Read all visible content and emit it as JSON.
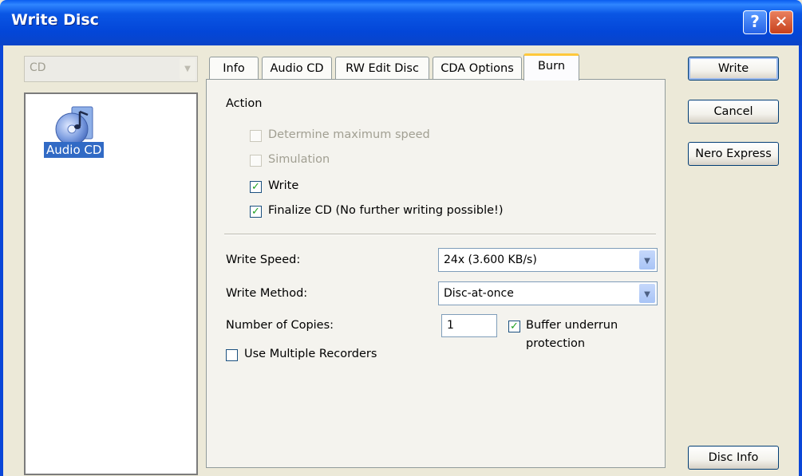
{
  "window": {
    "title": "Write Disc"
  },
  "title_buttons": {
    "help": "?",
    "close": "✕"
  },
  "disc_type": {
    "value": "CD"
  },
  "compilation_list": {
    "items": [
      {
        "label": "Audio CD",
        "icon": "audio-cd-icon"
      }
    ]
  },
  "tabs": [
    {
      "label": "Info"
    },
    {
      "label": "Audio CD"
    },
    {
      "label": "RW Edit Disc"
    },
    {
      "label": "CDA Options"
    },
    {
      "label": "Burn",
      "active": true
    }
  ],
  "burn": {
    "action_label": "Action",
    "options": [
      {
        "label": "Determine maximum speed",
        "checked": false,
        "enabled": false
      },
      {
        "label": "Simulation",
        "checked": false,
        "enabled": false
      },
      {
        "label": "Write",
        "checked": true,
        "enabled": true
      },
      {
        "label": "Finalize CD (No further writing possible!)",
        "checked": true,
        "enabled": true
      }
    ],
    "write_speed_label": "Write Speed:",
    "write_speed_value": "24x (3.600 KB/s)",
    "write_method_label": "Write Method:",
    "write_method_value": "Disc-at-once",
    "copies_label": "Number of Copies:",
    "copies_value": "1",
    "buffer_line1": "Buffer underrun",
    "buffer_line2": "protection",
    "buffer_checked": true,
    "multi_recorders_label": "Use Multiple Recorders",
    "multi_recorders_checked": false
  },
  "buttons": {
    "write": "Write",
    "cancel": "Cancel",
    "nero_express": "Nero Express",
    "disc_info": "Disc Info"
  },
  "colors": {
    "titlebar": "#0a56e4",
    "dialog_bg": "#ece9d8",
    "selection": "#316ac5",
    "check": "#21a121"
  }
}
